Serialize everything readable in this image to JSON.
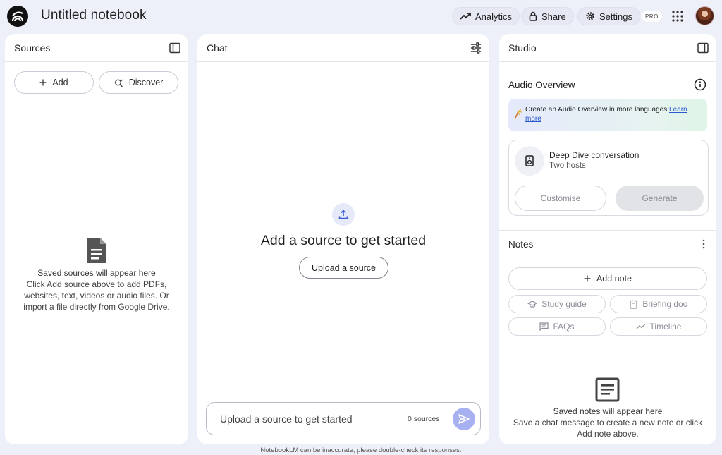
{
  "app": {
    "notebook_title": "Untitled notebook",
    "footer_note": "NotebookLM can be inaccurate; please double-check its responses."
  },
  "topbar": {
    "analytics_label": "Analytics",
    "share_label": "Share",
    "settings_label": "Settings",
    "pro_badge": "PRO"
  },
  "sources": {
    "title": "Sources",
    "add_label": "Add",
    "discover_label": "Discover",
    "empty_title": "Saved sources will appear here",
    "empty_line1": "Click Add source above to add PDFs,",
    "empty_line2": "websites, text, videos or audio files. Or",
    "empty_line3": "import a file directly from Google Drive."
  },
  "chat": {
    "title": "Chat",
    "headline": "Add a source to get started",
    "upload_label": "Upload a source",
    "input_placeholder": "Upload a source to get started",
    "source_count": "0 sources"
  },
  "studio": {
    "title": "Studio",
    "audio_overview_title": "Audio Overview",
    "promo_text": "Create an Audio Overview in more languages!",
    "promo_link": "Learn more",
    "deep_dive_title": "Deep Dive conversation",
    "deep_dive_sub": "Two hosts",
    "customise_label": "Customise",
    "generate_label": "Generate",
    "notes_title": "Notes",
    "add_note_label": "Add note",
    "study_guide_label": "Study guide",
    "briefing_doc_label": "Briefing doc",
    "faqs_label": "FAQs",
    "timeline_label": "Timeline",
    "empty_title": "Saved notes will appear here",
    "empty_line1": "Save a chat message to create a new note or click",
    "empty_line2": "Add note above."
  },
  "colors": {
    "background": "#eef0f9",
    "panel": "#ffffff",
    "send_button": "#a7b0f0",
    "link": "#2a59d1"
  },
  "icons": {
    "logo": "notebooklm-logo-icon",
    "analytics": "trending-up-icon",
    "share": "lock-icon",
    "settings": "gear-icon",
    "apps": "apps-grid-icon",
    "collapse": "panel-toggle-icon",
    "tune": "tune-sliders-icon",
    "info": "info-icon",
    "upload": "upload-icon",
    "send": "send-icon"
  }
}
